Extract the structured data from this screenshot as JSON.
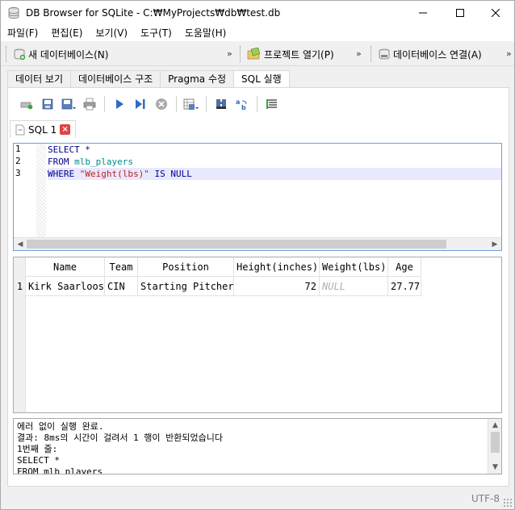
{
  "window": {
    "title": "DB Browser for SQLite - C:₩MyProjects₩db₩test.db",
    "minimize_label": "—",
    "maximize_label": "☐",
    "close_label": "✕"
  },
  "menu": [
    "파일(F)",
    "편집(E)",
    "보기(V)",
    "도구(T)",
    "도움말(H)"
  ],
  "toolbar": {
    "new_db": "새 데이터베이스(N)",
    "open_project": "프로젝트 열기(P)",
    "db_connect": "데이터베이스 연결(A)",
    "overflow": "»"
  },
  "tabs": [
    "데이터 보기",
    "데이터베이스 구조",
    "Pragma 수정",
    "SQL 실행"
  ],
  "active_tab": "SQL 실행",
  "sql_tab": {
    "label": "SQL 1",
    "close": "×"
  },
  "editor": {
    "line_numbers": [
      "1",
      "2",
      "3"
    ],
    "lines": [
      [
        {
          "t": "SELECT *",
          "c": "kw"
        }
      ],
      [
        {
          "t": "FROM ",
          "c": "kw"
        },
        {
          "t": "mlb_players",
          "c": "ident"
        }
      ],
      [
        {
          "t": "WHERE ",
          "c": "kw"
        },
        {
          "t": "\"Weight(lbs)\"",
          "c": "str"
        },
        {
          "t": " IS NULL",
          "c": "kw"
        }
      ]
    ]
  },
  "results": {
    "columns": [
      "Name",
      "Team",
      "Position",
      "Height(inches)",
      "Weight(lbs)",
      "Age"
    ],
    "rows": [
      {
        "row_number": "1",
        "cells": [
          "Kirk Saarloos",
          "CIN",
          "Starting Pitcher",
          "72",
          "NULL",
          "27.77"
        ]
      }
    ]
  },
  "messages": {
    "text": "에러 없이 실행 완료.\n결과: 8ms의 시간이 걸려서 1 행이 반환되었습니다\n1번째 줄:\nSELECT *\nFROM mlb_players"
  },
  "status": {
    "encoding": "UTF-8"
  }
}
